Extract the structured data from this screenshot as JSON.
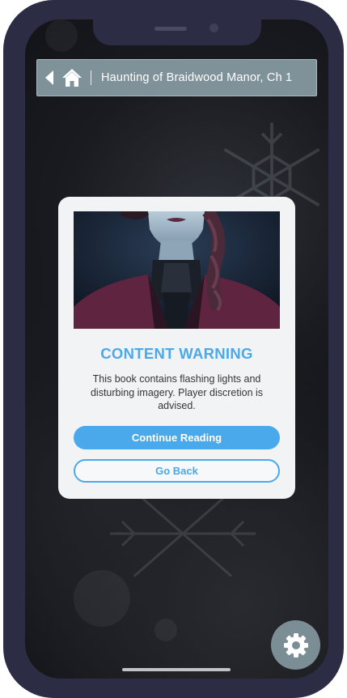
{
  "header": {
    "back_icon": "chevron-left-icon",
    "home_icon": "home-icon",
    "book_title": "Haunting of Braidwood Manor, Ch 1"
  },
  "modal": {
    "illustration": "character-portrait",
    "title": "CONTENT WARNING",
    "message": "This book contains flashing lights and disturbing imagery. Player discretion is advised.",
    "primary_button": "Continue Reading",
    "secondary_button": "Go Back"
  },
  "settings_icon": "gear-icon",
  "colors": {
    "accent": "#4aa9ea",
    "header_bar": "#7f929a",
    "phone_frame": "#2c2c44",
    "modal_bg": "#f2f3f5"
  }
}
